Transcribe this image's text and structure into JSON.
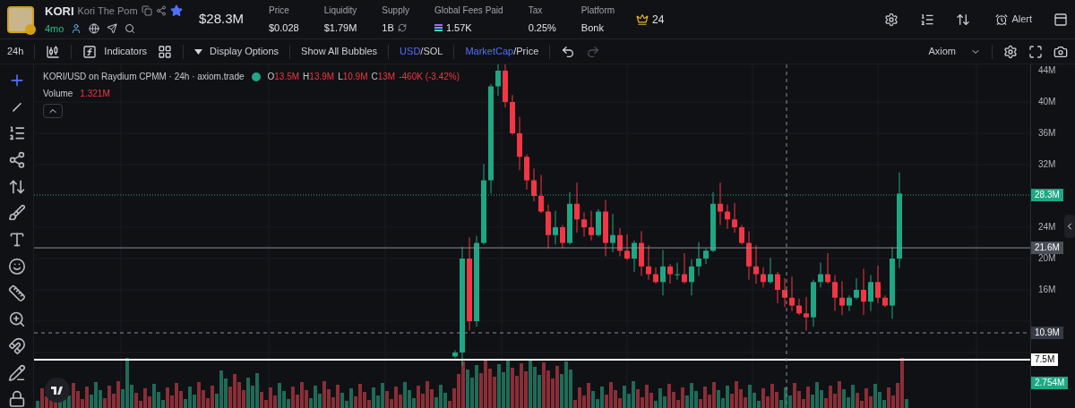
{
  "token": {
    "symbol": "KORI",
    "name": "Kori The Pom",
    "age": "4mo",
    "starred": true
  },
  "market_cap": "$28.3M",
  "stats": [
    {
      "label": "Price",
      "value": "$0.028",
      "kind": "plain"
    },
    {
      "label": "Liquidity",
      "value": "$1.79M",
      "kind": "plain"
    },
    {
      "label": "Supply",
      "value": "1B",
      "kind": "refresh"
    },
    {
      "label": "Global Fees Paid",
      "value": "1.57K",
      "kind": "sol"
    },
    {
      "label": "Tax",
      "value": "0.25%",
      "kind": "plain"
    },
    {
      "label": "Platform",
      "value": "Bonk",
      "kind": "plain"
    }
  ],
  "holders_badge": "24",
  "alert": "Alert",
  "toolbar": {
    "interval": "24h",
    "indicators": "Indicators",
    "display_options": "Display Options",
    "bubbles": "Show All Bubbles",
    "separator": "/",
    "currency": [
      {
        "label": "USD",
        "selected": true
      },
      {
        "label": "SOL",
        "selected": false
      }
    ],
    "mode": [
      {
        "label": "MarketCap",
        "selected": true
      },
      {
        "label": "Price",
        "selected": false
      }
    ],
    "theme": "Axiom"
  },
  "legend": {
    "title": "KORI/USD on Raydium CPMM · 24h · axiom.trade",
    "ohlc": [
      {
        "key": "O",
        "value": "13.5M"
      },
      {
        "key": "H",
        "value": "13.9M"
      },
      {
        "key": "L",
        "value": "10.9M"
      },
      {
        "key": "C",
        "value": "13M"
      }
    ],
    "change": "-460K (-3.42%)",
    "volume_label": "Volume",
    "volume": "1.321M"
  },
  "y_axis": [
    "44M",
    "40M",
    "36M",
    "32M",
    "24M",
    "20M",
    "16M"
  ],
  "price_tags": [
    {
      "value": "28.3M",
      "kind": "last"
    },
    {
      "value": "21.6M",
      "kind": "line"
    },
    {
      "value": "10.9M",
      "kind": "crosshair"
    },
    {
      "value": "7.5M",
      "kind": "marker"
    },
    {
      "value": "2.754M",
      "kind": "volume"
    }
  ]
}
